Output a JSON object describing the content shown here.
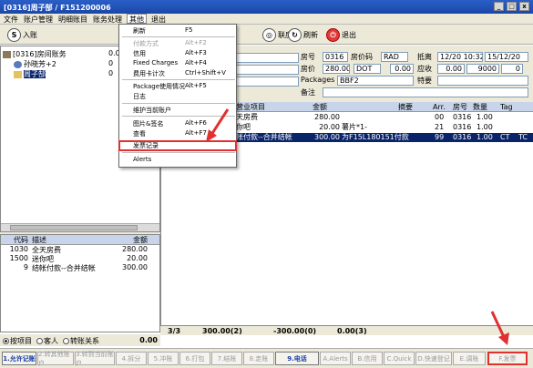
{
  "window": {
    "title": "[0316]周子郜 / F151200006"
  },
  "menubar": [
    "文件",
    "账户管理",
    "明细账目",
    "账务处理",
    "其他",
    "退出"
  ],
  "toolbar": {
    "left": [
      {
        "icon": "S",
        "label": "入账"
      }
    ],
    "right": [
      {
        "icon": "◎",
        "label": "联房"
      },
      {
        "icon": "↻",
        "label": "刷新"
      },
      {
        "icon": "⏻",
        "label": "退出"
      }
    ]
  },
  "dropdown": [
    {
      "label": "刷新",
      "key": "F5",
      "enabled": true
    },
    {
      "label": "付款方式",
      "key": "Alt+F2",
      "enabled": false
    },
    {
      "label": "信用",
      "key": "Alt+F3",
      "enabled": true
    },
    {
      "label": "Fixed Charges",
      "key": "Alt+F4",
      "enabled": true
    },
    {
      "label": "费用卡计次",
      "key": "Ctrl+Shift+V",
      "enabled": true
    },
    {
      "label": "Package使用情况",
      "key": "Alt+F5",
      "enabled": true
    },
    {
      "label": "日志",
      "key": "",
      "enabled": true
    },
    {
      "label": "维护当前账户",
      "key": "",
      "enabled": true
    },
    {
      "label": "图片&签名",
      "key": "Alt+F6",
      "enabled": true
    },
    {
      "label": "查看",
      "key": "Alt+F7",
      "enabled": true
    },
    {
      "label": "发票记录",
      "key": "",
      "enabled": true
    },
    {
      "label": "Alerts",
      "key": "",
      "enabled": true
    }
  ],
  "tree": {
    "root": {
      "label": "[0316]房间账务",
      "value": "0.00"
    },
    "child1": {
      "label": "孙晓芳+2",
      "value": "0"
    },
    "child2": {
      "label": "周子郜",
      "value": "0"
    }
  },
  "left_table": {
    "headers": [
      "代码",
      "描述",
      "金额"
    ],
    "rows": [
      {
        "code": "1030",
        "desc": "全天房费",
        "amount": "280.00"
      },
      {
        "code": "1500",
        "desc": "迷你吧",
        "amount": "20.00"
      },
      {
        "code": "9",
        "desc": "结帐付款--合并结帐",
        "amount": "300.00"
      }
    ]
  },
  "radios": [
    {
      "label": "按项目",
      "checked": true
    },
    {
      "label": "客人",
      "checked": false
    },
    {
      "label": "转账关系",
      "checked": false
    }
  ],
  "left_total": "0.00",
  "info": {
    "room_label": "房号",
    "room_value": "0316",
    "rate_code_label": "房价码",
    "rate_code_value": "RAD",
    "arrival_label": "抵离",
    "arrival_value": "12/20 10:32",
    "departure_value": "15/12/20",
    "price_label": "房价",
    "price_value": "280.00",
    "dot_value": "DOT",
    "dot_amount": "0.00",
    "receivable_label": "应收",
    "receivable_value": "0.00",
    "receivable_extra": "9000",
    "receivable_zero": "0",
    "packages_label": "Packages",
    "packages_value": "BBF2",
    "special_label": "特要",
    "remark_label": "备注"
  },
  "grid": {
    "headers": [
      "营业项目",
      "金额",
      "摘要",
      "Arr.",
      "房号",
      "数量",
      "Tag"
    ],
    "rows": [
      {
        "item": "天房费",
        "amount": "280.00",
        "summary": "",
        "arr": "00",
        "room": "0316",
        "qty": "1.00",
        "tag": "",
        "extra": ""
      },
      {
        "item": "你吧",
        "amount": "20.00",
        "summary": "薯片*1-",
        "arr": "21",
        "room": "0316",
        "qty": "1.00",
        "tag": "",
        "extra": ""
      },
      {
        "item": "帐付款--合并结帐",
        "amount": "300.00",
        "summary": "为F15L180151付款",
        "arr": "99",
        "room": "0316",
        "qty": "1.00",
        "tag": "CT",
        "extra": "TC"
      }
    ]
  },
  "totals": {
    "count": "3/3",
    "debit": "300.00(2)",
    "credit": "-300.00(0)",
    "balance": "0.00(3)"
  },
  "fkeys": [
    {
      "label": "1.允许记账",
      "enabled": true
    },
    {
      "label": "2.转其他账户",
      "enabled": false
    },
    {
      "label": "3.转到当前账户",
      "enabled": false
    },
    {
      "label": "4.拆分",
      "enabled": false
    },
    {
      "label": "5.冲账",
      "enabled": false
    },
    {
      "label": "6.打包",
      "enabled": false
    },
    {
      "label": "7.结账",
      "enabled": false
    },
    {
      "label": "8.走账",
      "enabled": false
    },
    {
      "label": "9.电话",
      "enabled": true
    },
    {
      "label": "A.Alerts",
      "enabled": false
    },
    {
      "label": "B.信用",
      "enabled": false
    },
    {
      "label": "C.Quick",
      "enabled": false
    },
    {
      "label": "D.快速登记",
      "enabled": false
    },
    {
      "label": "E.调账",
      "enabled": false
    },
    {
      "label": "F.发票",
      "enabled": false
    }
  ],
  "colors": {
    "title_bar": "#1a47a8",
    "selection": "#0a246a",
    "highlight": "#e03030",
    "header": "#c8d4ea"
  }
}
